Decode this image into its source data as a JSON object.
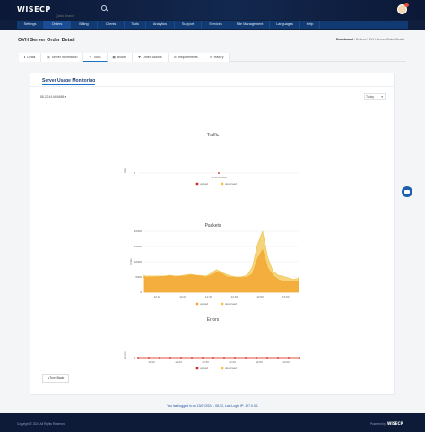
{
  "header": {
    "logo_text": "WISECP",
    "search_placeholder": "Quick Search"
  },
  "nav": {
    "items": [
      {
        "label": "Settings",
        "width": 30
      },
      {
        "label": "Orders",
        "width": 30
      },
      {
        "label": "Billing",
        "width": 30
      },
      {
        "label": "Clients",
        "width": 30
      },
      {
        "label": "Tools",
        "width": 24
      },
      {
        "label": "Analytics",
        "width": 32
      },
      {
        "label": "Support",
        "width": 30
      },
      {
        "label": "Services",
        "width": 32
      },
      {
        "label": "Site Management",
        "width": 44
      },
      {
        "label": "Languages",
        "width": 34
      },
      {
        "label": "Help",
        "width": 22
      }
    ]
  },
  "page": {
    "title": "OVH Server Order Detail",
    "breadcrumb": [
      "Dashboard",
      "Orders",
      "OVH Server Order Detail"
    ]
  },
  "tabs": [
    {
      "label": "Detail",
      "icon": "info-icon",
      "glyph": "ℹ"
    },
    {
      "label": "Server Information",
      "icon": "server-icon",
      "glyph": "▤"
    },
    {
      "label": "Tools",
      "icon": "tools-icon",
      "glyph": "✎"
    },
    {
      "label": "Blocks",
      "icon": "block-icon",
      "glyph": "▦"
    },
    {
      "label": "Order Addons",
      "icon": "plus-icon",
      "glyph": "✚"
    },
    {
      "label": "Requirements",
      "icon": "list-icon",
      "glyph": "☰"
    },
    {
      "label": "History",
      "icon": "history-icon",
      "glyph": "↺"
    }
  ],
  "monitoring": {
    "title": "Server Usage Monitoring",
    "ip_select": "88.22.44.66/6688",
    "period": "Today"
  },
  "chart_data": [
    {
      "type": "line",
      "title": "Traffic",
      "ylabel": "bps",
      "x": [
        "11:46:55.000"
      ],
      "ylim": [
        0,
        1
      ],
      "yticks": [
        "0"
      ],
      "series": [
        {
          "name": "upload",
          "color": "#d7262b",
          "values": [
            0
          ]
        },
        {
          "name": "download",
          "color": "#f0c244",
          "values": [
            0
          ]
        }
      ]
    },
    {
      "type": "area",
      "title": "Packets",
      "ylabel": "Pckts",
      "x": [
        "12:10",
        "12:20",
        "12:30",
        "12:40",
        "12:50",
        "13:00"
      ],
      "ylim": [
        0,
        20000
      ],
      "yticks": [
        "0",
        "5000",
        "10000",
        "15000",
        "20000"
      ],
      "series": [
        {
          "name": "upload",
          "color": "#f3a732",
          "values": [
            4900,
            5000,
            5000,
            5100,
            5200,
            5300,
            5100,
            5200,
            5300,
            5600,
            5500,
            5200,
            5000,
            5600,
            6400,
            6200,
            5100,
            4900,
            4800,
            4800,
            4900,
            6000,
            11000,
            14000,
            8000,
            5600,
            4200,
            3600,
            3500,
            3400,
            3500
          ]
        },
        {
          "name": "download",
          "color": "#f0c244",
          "values": [
            5300,
            5300,
            5300,
            5300,
            5300,
            5600,
            5300,
            5400,
            5700,
            5900,
            5600,
            5500,
            5300,
            6300,
            7400,
            6700,
            5800,
            5300,
            5000,
            5100,
            5600,
            8200,
            15600,
            20000,
            11400,
            7000,
            5600,
            5200,
            4700,
            4200,
            4600
          ]
        }
      ]
    },
    {
      "type": "line",
      "title": "Errors",
      "ylabel": "Errors",
      "x": [
        "12:10",
        "12:20",
        "12:30",
        "12:40",
        "12:50",
        "13:00"
      ],
      "ylim": [
        0,
        1
      ],
      "yticks": [
        "0"
      ],
      "series": [
        {
          "name": "upload",
          "color": "#d7262b",
          "values": [
            0,
            0,
            0,
            0,
            0,
            0,
            0,
            0,
            0,
            0,
            0,
            0,
            0,
            0,
            0,
            0
          ]
        },
        {
          "name": "download",
          "color": "#f0c244",
          "values": [
            0,
            0,
            0,
            0,
            0,
            0,
            0,
            0,
            0,
            0,
            0,
            0,
            0,
            0,
            0,
            0
          ]
        }
      ]
    }
  ],
  "actions": {
    "back_label": "Turn Back"
  },
  "last_login": "You last logged in on 13/07/2024 - 08:12, Last Login IP: 127.0.0.1",
  "footer": {
    "copyright": "Copyright © 2024 All Rights Reserved.",
    "powered_by": "Powered by",
    "brand": "WISECP"
  }
}
